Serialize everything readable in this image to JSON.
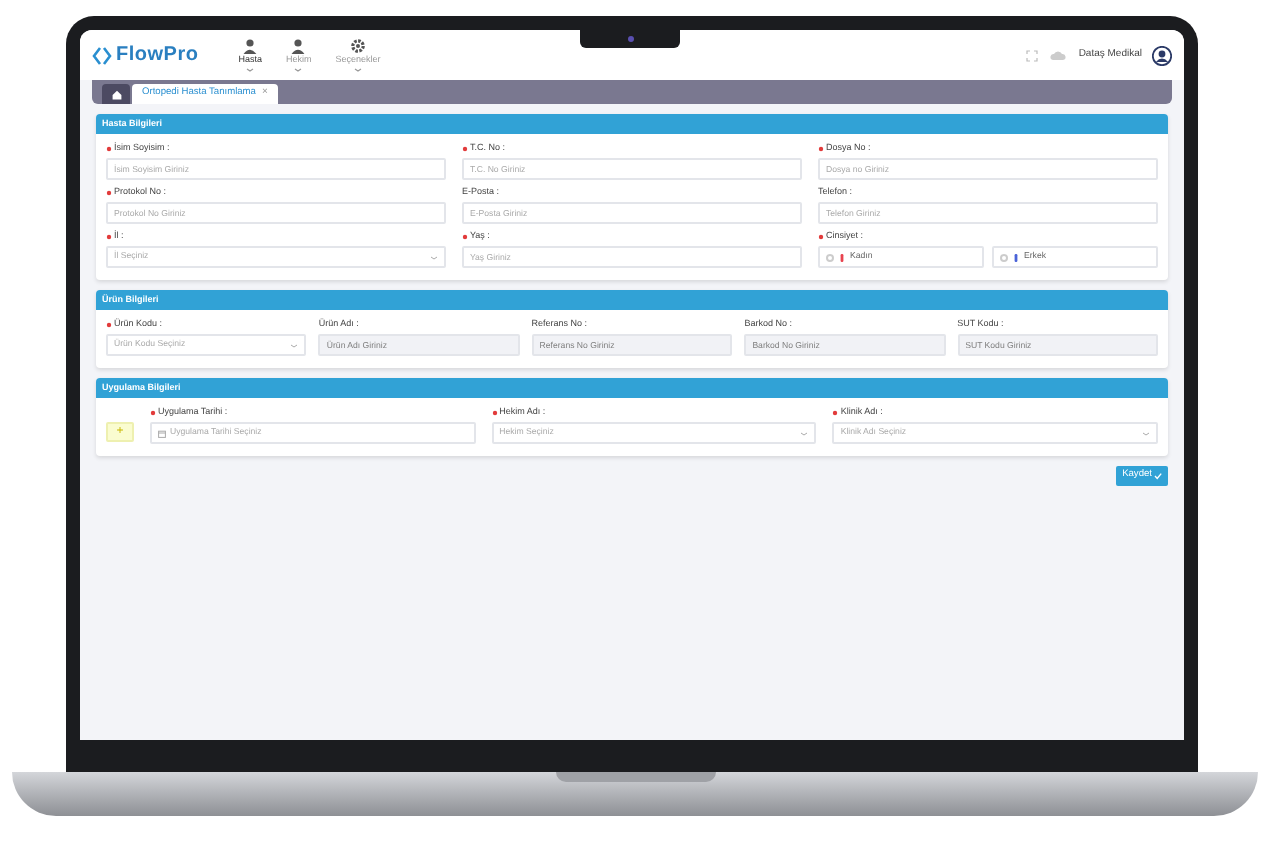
{
  "header": {
    "logo": "FlowPro",
    "nav": [
      {
        "label": "Hasta",
        "selected": true
      },
      {
        "label": "Hekim",
        "selected": false
      },
      {
        "label": "Seçenekler",
        "selected": false
      }
    ],
    "user": "Dataş Medikal"
  },
  "tabs": [
    {
      "kind": "home",
      "selected": false
    },
    {
      "kind": "page",
      "label": "Ortopedi Hasta Tanımlama",
      "close": "×",
      "selected": true
    }
  ],
  "sections": [
    {
      "title": "Hasta Bilgileri",
      "fields": [
        {
          "kind": "input",
          "label": "İsim Soyisim :",
          "required": true,
          "placeholder": "İsim Soyisim Giriniz"
        },
        {
          "kind": "input",
          "label": "T.C. No :",
          "required": true,
          "placeholder": "T.C. No Giriniz"
        },
        {
          "kind": "input",
          "label": "Dosya No :",
          "required": true,
          "placeholder": "Dosya no Giriniz"
        },
        {
          "kind": "input",
          "label": "Protokol No :",
          "required": true,
          "placeholder": "Protokol No Giriniz"
        },
        {
          "kind": "input",
          "label": "E-Posta :",
          "required": false,
          "placeholder": "E-Posta Giriniz"
        },
        {
          "kind": "input",
          "label": "Telefon :",
          "required": false,
          "placeholder": "Telefon Giriniz"
        },
        {
          "kind": "select",
          "label": "İl :",
          "required": true,
          "placeholder": "İl Seçiniz"
        },
        {
          "kind": "input",
          "label": "Yaş :",
          "required": true,
          "placeholder": "Yaş Giriniz"
        },
        {
          "kind": "radio",
          "label": "Cinsiyet :",
          "required": true,
          "options": [
            {
              "label": "Kadın",
              "selected": false,
              "color": "#e8434f"
            },
            {
              "label": "Erkek",
              "selected": false,
              "color": "#4a63d8"
            }
          ]
        }
      ]
    },
    {
      "title": "Ürün Bilgileri",
      "fields": [
        {
          "kind": "select",
          "label": "Ürün Kodu :",
          "required": true,
          "placeholder": "Ürün Kodu Seçiniz"
        },
        {
          "kind": "disabled",
          "label": "Ürün Adı :",
          "required": false,
          "placeholder": "Ürün Adı Giriniz"
        },
        {
          "kind": "disabled",
          "label": "Referans No :",
          "required": false,
          "placeholder": "Referans No Giriniz"
        },
        {
          "kind": "disabled",
          "label": "Barkod No :",
          "required": false,
          "placeholder": "Barkod No Giriniz"
        },
        {
          "kind": "disabled",
          "label": "SUT Kodu :",
          "required": false,
          "placeholder": "SUT Kodu Giriniz"
        }
      ]
    },
    {
      "title": "Uygulama Bilgileri",
      "add_button": "+",
      "fields": [
        {
          "kind": "date",
          "label": "Uygulama Tarihi :",
          "required": true,
          "placeholder": "Uygulama Tarihi Seçiniz"
        },
        {
          "kind": "select",
          "label": "Hekim Adı :",
          "required": true,
          "placeholder": "Hekim Seçiniz"
        },
        {
          "kind": "select",
          "label": "Klinik Adı :",
          "required": true,
          "placeholder": "Klinik Adı Seçiniz"
        }
      ]
    }
  ],
  "save_button": "Kaydet"
}
